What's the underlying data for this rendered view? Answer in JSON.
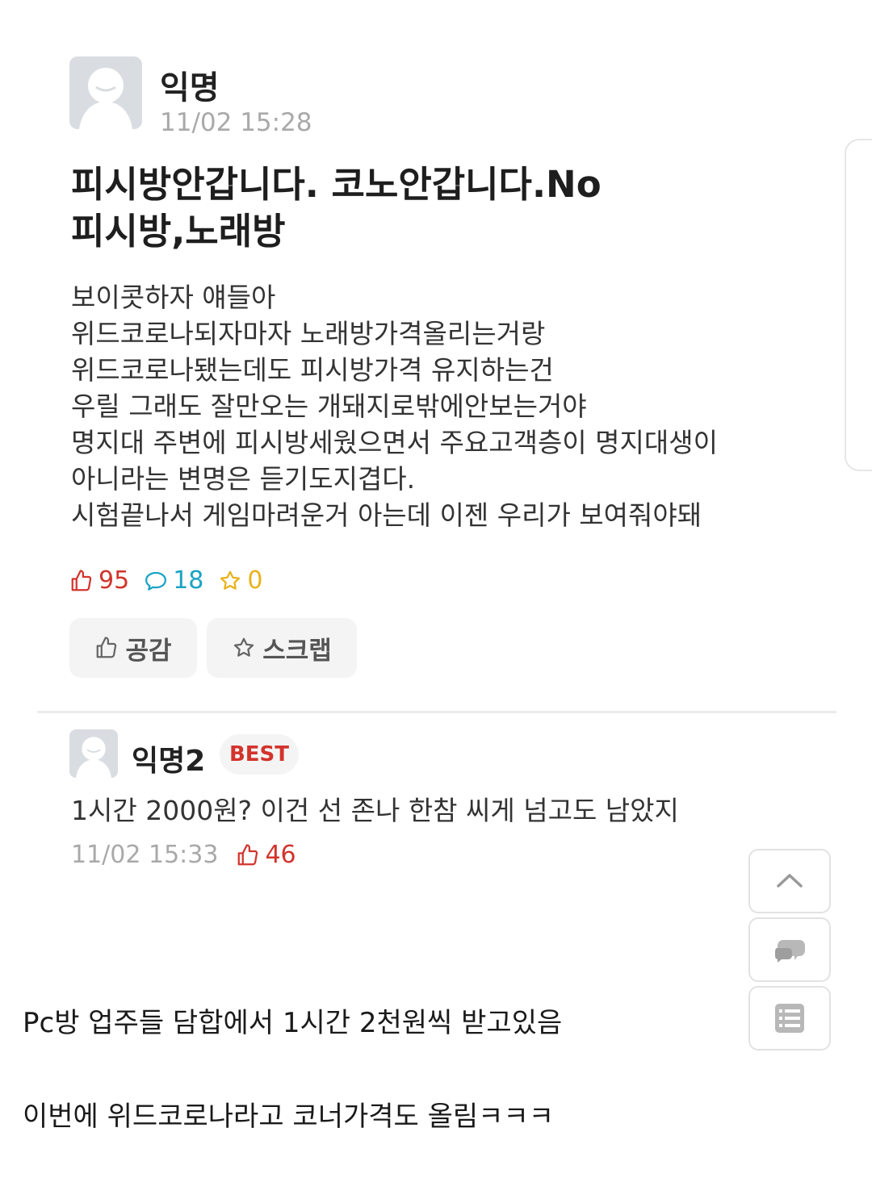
{
  "post": {
    "author": "익명",
    "time": "11/02 15:28",
    "title_line1": "피시방안갑니다. 코노안갑니다.No",
    "title_line2": "피시방,노래방",
    "body": [
      "보이콧하자 얘들아",
      "위드코로나되자마자 노래방가격올리는거랑",
      "위드코로나됐는데도 피시방가격 유지하는건",
      "우릴 그래도 잘만오는 개돼지로밖에안보는거야",
      "명지대 주변에 피시방세웠으면서 주요고객층이 명지대생이",
      "아니라는 변명은 듣기도지겹다.",
      "시험끝나서 게임마려운거 아는데 이젠 우리가 보여줘야돼"
    ],
    "likes": "95",
    "comments": "18",
    "scraps": "0",
    "like_button": "공감",
    "scrap_button": "스크랩"
  },
  "comment": {
    "author": "익명2",
    "badge": "BEST",
    "text": "1시간 2000원? 이건 선 존나 한참 씨게 넘고도 남았지",
    "time": "11/02 15:33",
    "likes": "46"
  },
  "captions": {
    "line1": "Pc방 업주들 담합에서 1시간 2천원씩 받고있음",
    "line2": "이번에 위드코로나라고 코너가격도 올림ㅋㅋㅋ"
  },
  "colors": {
    "like": "#d2342c",
    "comment": "#1aa3c4",
    "scrap": "#e8b21b",
    "meta": "#a9a9a9"
  },
  "icons": {
    "avatar": "default-profile-icon",
    "like": "thumbs-up-icon",
    "comment": "speech-bubble-icon",
    "scrap": "star-icon",
    "top": "chevron-up-icon",
    "chat": "chat-icon",
    "list": "list-icon"
  }
}
